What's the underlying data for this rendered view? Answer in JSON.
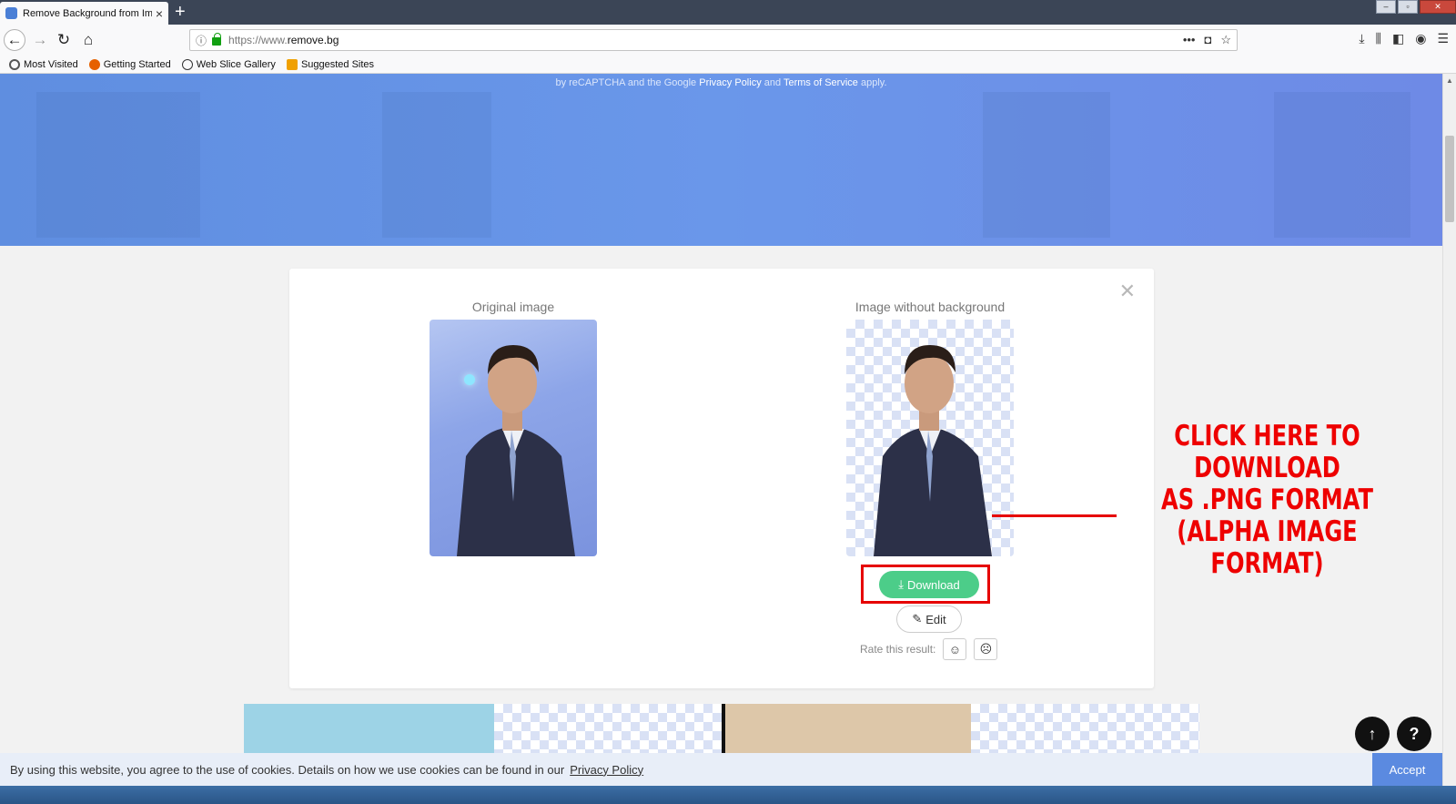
{
  "browser": {
    "tab_title": "Remove Background from Ima",
    "url_protocol": "https://www.",
    "url_host": "remove.bg",
    "bookmarks": [
      "Most Visited",
      "Getting Started",
      "Web Slice Gallery",
      "Suggested Sites"
    ]
  },
  "hero": {
    "recaptcha_prefix": "by reCAPTCHA and the Google",
    "privacy_policy": "Privacy Policy",
    "and": "and",
    "terms": "Terms of Service",
    "suffix": "apply."
  },
  "result": {
    "original_title": "Original image",
    "nobg_title": "Image without background",
    "download_label": "Download",
    "edit_label": "Edit",
    "rate_label": "Rate this result:"
  },
  "annotation": {
    "line1": "CLICK HERE TO DOWNLOAD",
    "line2": "AS .PNG FORMAT",
    "line3": "(ALPHA IMAGE FORMAT)"
  },
  "cookie": {
    "text": "By using this website, you agree to the use of cookies. Details on how we use cookies can be found in our",
    "link": "Privacy Policy",
    "accept": "Accept"
  },
  "help_label": "?",
  "colors": {
    "accent_blue": "#5b8ae0",
    "download_green": "#4ccd89",
    "annotation_red": "#e60000"
  }
}
